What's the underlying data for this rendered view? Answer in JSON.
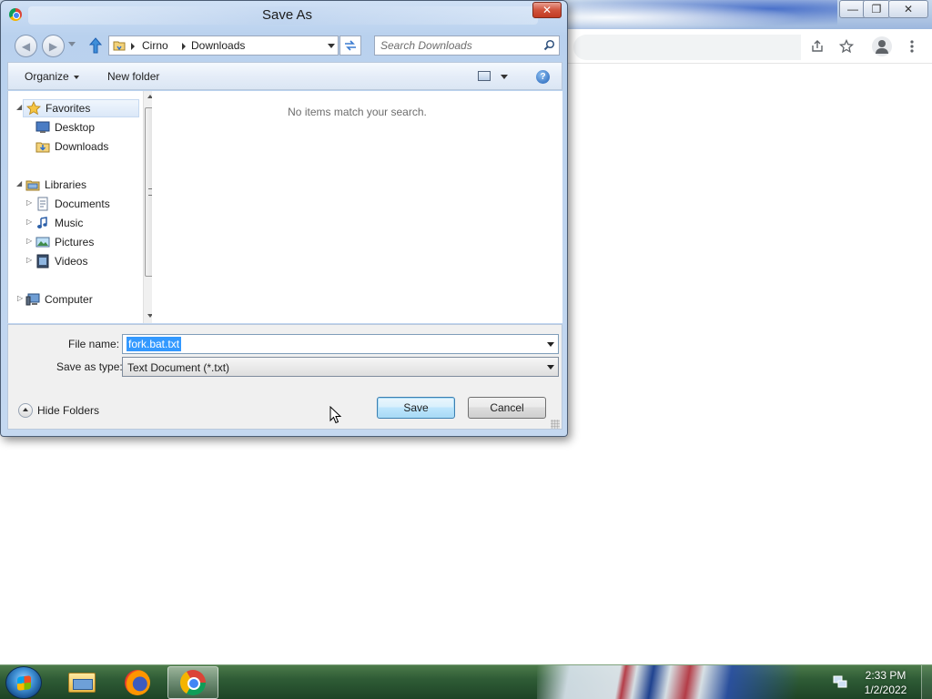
{
  "dialog": {
    "title": "Save As",
    "close_glyph": "✕",
    "nav": {
      "back_glyph": "◀",
      "forward_glyph": "▶",
      "breadcrumb": [
        "Cirno",
        "Downloads"
      ],
      "search_placeholder": "Search Downloads"
    },
    "command_bar": {
      "organize": "Organize",
      "new_folder": "New folder",
      "help_glyph": "?"
    },
    "tree": [
      {
        "label": "Favorites",
        "icon": "star-icon",
        "level": 0,
        "expanded": true
      },
      {
        "label": "Desktop",
        "icon": "desktop-icon",
        "level": 1
      },
      {
        "label": "Downloads",
        "icon": "downloads-folder-icon",
        "level": 1
      },
      {
        "label": "Libraries",
        "icon": "libraries-icon",
        "level": 0,
        "expanded": true
      },
      {
        "label": "Documents",
        "icon": "documents-icon",
        "level": 1
      },
      {
        "label": "Music",
        "icon": "music-icon",
        "level": 1
      },
      {
        "label": "Pictures",
        "icon": "pictures-icon",
        "level": 1
      },
      {
        "label": "Videos",
        "icon": "videos-icon",
        "level": 1
      },
      {
        "label": "Computer",
        "icon": "computer-icon",
        "level": 0,
        "expanded": false
      }
    ],
    "empty_message": "No items match your search.",
    "file_name_label": "File name:",
    "file_name_value": "fork.bat.txt",
    "save_as_type_label": "Save as type:",
    "save_as_type_value": "Text Document (*.txt)",
    "hide_folders": "Hide Folders",
    "save_button": "Save",
    "cancel_button": "Cancel"
  },
  "browser": {
    "window_controls": [
      "—",
      "❐",
      "✕"
    ]
  },
  "taskbar": {
    "time": "2:33 PM",
    "date": "1/2/2022",
    "pinned": [
      "windows-explorer-icon",
      "firefox-icon",
      "chrome-icon"
    ]
  },
  "colors": {
    "selection": "#3399ff",
    "accent_button": "#3c7fb1",
    "close_button": "#c23a22"
  }
}
